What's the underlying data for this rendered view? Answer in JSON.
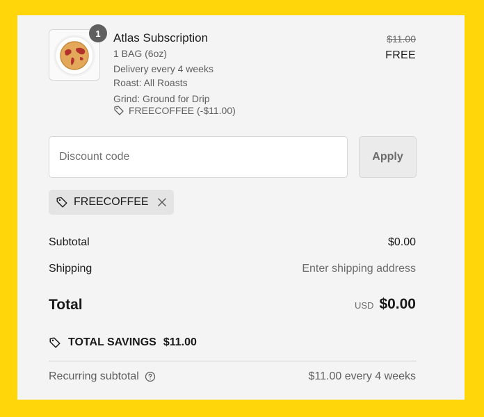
{
  "product": {
    "quantity": "1",
    "title": "Atlas Subscription",
    "variant_lines": [
      "1 BAG (6oz)",
      "Delivery every 4 weeks",
      "Roast: All Roasts",
      "Grind: Ground for Drip"
    ],
    "discount_line": "FREECOFFEE (-$11.00)",
    "original_price": "$11.00",
    "final_price": "FREE"
  },
  "discount": {
    "placeholder": "Discount code",
    "apply_label": "Apply",
    "applied_code": "FREECOFFEE"
  },
  "summary": {
    "subtotal_label": "Subtotal",
    "subtotal_value": "$0.00",
    "shipping_label": "Shipping",
    "shipping_value": "Enter shipping address",
    "total_label": "Total",
    "currency": "USD",
    "total_value": "$0.00",
    "savings_label": "TOTAL SAVINGS",
    "savings_value": "$11.00",
    "recurring_label": "Recurring subtotal",
    "recurring_value": "$11.00 every 4 weeks"
  },
  "colors": {
    "frame": "#FFD60A",
    "panel": "#f4f4f4",
    "badge": "#5f5f5f"
  },
  "icons": {
    "tag": "tag-icon",
    "close": "close-icon",
    "help": "question-circle-icon"
  }
}
